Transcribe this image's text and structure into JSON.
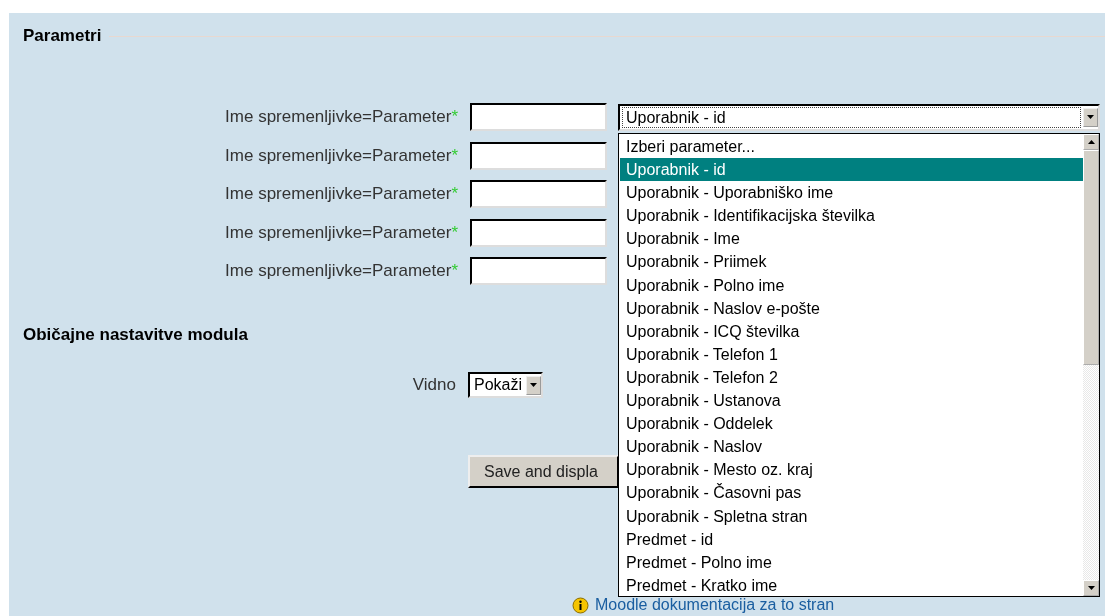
{
  "parameters_section": {
    "title": "Parametri",
    "rows": [
      {
        "label": "Ime spremenljivke=Parameter",
        "required_mark": "*"
      },
      {
        "label": "Ime spremenljivke=Parameter",
        "required_mark": "*"
      },
      {
        "label": "Ime spremenljivke=Parameter",
        "required_mark": "*"
      },
      {
        "label": "Ime spremenljivke=Parameter",
        "required_mark": "*"
      },
      {
        "label": "Ime spremenljivke=Parameter",
        "required_mark": "*"
      }
    ],
    "parameter_select": {
      "value": "Uporabnik - id",
      "expanded": true,
      "options": [
        {
          "label": "Izberi parameter...",
          "selected": false
        },
        {
          "label": "Uporabnik - id",
          "selected": true
        },
        {
          "label": "Uporabnik - Uporabniško ime",
          "selected": false
        },
        {
          "label": "Uporabnik - Identifikacijska številka",
          "selected": false
        },
        {
          "label": "Uporabnik - Ime",
          "selected": false
        },
        {
          "label": "Uporabnik - Priimek",
          "selected": false
        },
        {
          "label": "Uporabnik - Polno ime",
          "selected": false
        },
        {
          "label": "Uporabnik - Naslov e-pošte",
          "selected": false
        },
        {
          "label": "Uporabnik - ICQ številka",
          "selected": false
        },
        {
          "label": "Uporabnik - Telefon 1",
          "selected": false
        },
        {
          "label": "Uporabnik - Telefon 2",
          "selected": false
        },
        {
          "label": "Uporabnik - Ustanova",
          "selected": false
        },
        {
          "label": "Uporabnik - Oddelek",
          "selected": false
        },
        {
          "label": "Uporabnik - Naslov",
          "selected": false
        },
        {
          "label": "Uporabnik - Mesto oz. kraj",
          "selected": false
        },
        {
          "label": "Uporabnik - Časovni pas",
          "selected": false
        },
        {
          "label": "Uporabnik - Spletna stran",
          "selected": false
        },
        {
          "label": "Predmet - id",
          "selected": false
        },
        {
          "label": "Predmet - Polno ime",
          "selected": false
        },
        {
          "label": "Predmet - Kratko ime",
          "selected": false
        }
      ]
    }
  },
  "module_settings": {
    "title": "Običajne nastavitve modula",
    "visible_label": "Vidno",
    "visible_value": "Pokaži"
  },
  "save_button": "Save and displa",
  "footer_link": "Moodle dokumentacija za to stran"
}
